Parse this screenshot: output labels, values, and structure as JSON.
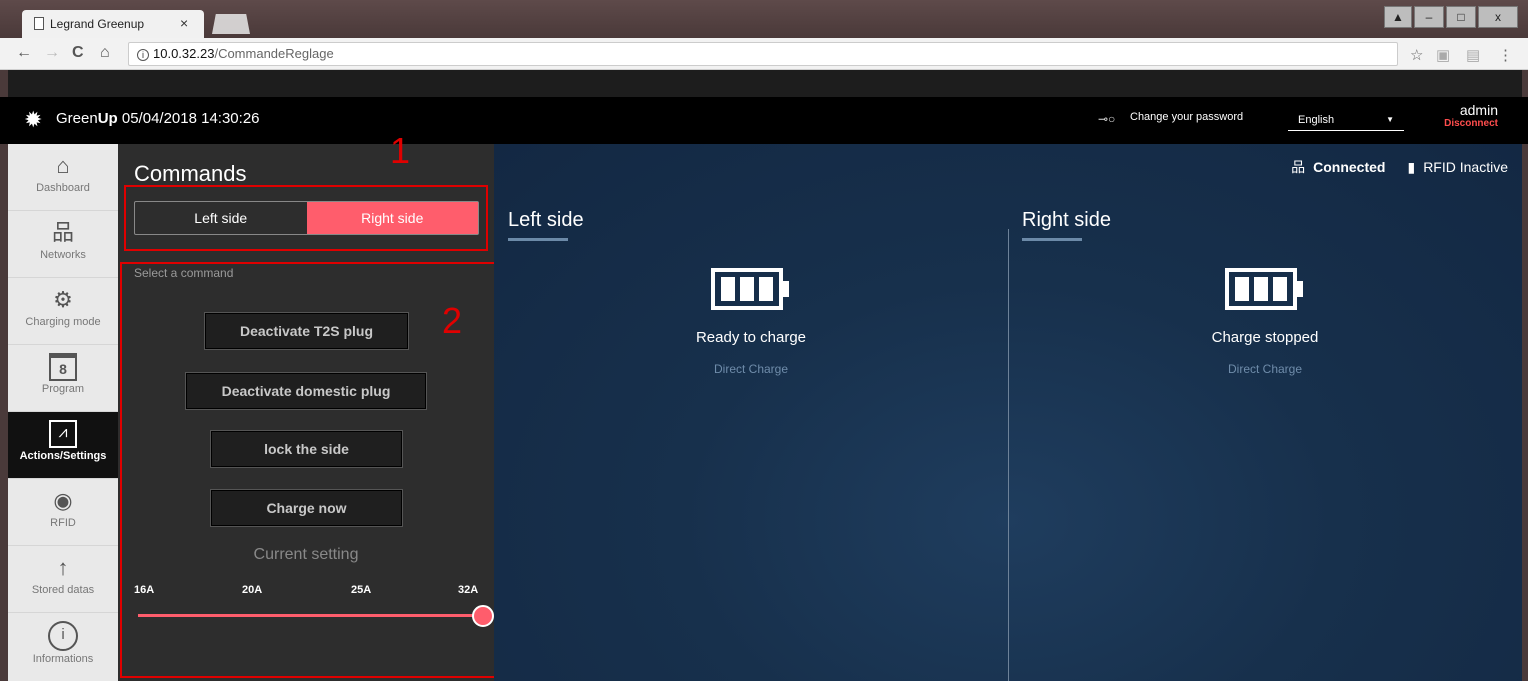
{
  "browser": {
    "tab_title": "Legrand Greenup",
    "tab_close": "×",
    "url_host": "10.0.32.23",
    "url_path": "/CommandeReglage",
    "window_controls": [
      "▲",
      "–",
      "□",
      "x"
    ]
  },
  "header": {
    "brand_prefix": "Green",
    "brand_bold": "Up",
    "datetime": "05/04/2018 14:30:26",
    "change_password": "Change your password",
    "language": "English",
    "user": "admin",
    "disconnect": "Disconnect"
  },
  "sidebar": {
    "items": [
      {
        "label": "Dashboard",
        "icon": "home-icon"
      },
      {
        "label": "Networks",
        "icon": "network-icon"
      },
      {
        "label": "Charging mode",
        "icon": "gear-icon"
      },
      {
        "label": "Program",
        "icon": "calendar-icon",
        "glyph": "8"
      },
      {
        "label": "Actions/Settings",
        "icon": "clipboard-pulse-icon",
        "active": true
      },
      {
        "label": "RFID",
        "icon": "rfid-icon"
      },
      {
        "label": "Stored datas",
        "icon": "upload-icon"
      },
      {
        "label": "Informations",
        "icon": "info-icon"
      }
    ]
  },
  "commands": {
    "title": "Commands",
    "toggle": {
      "left": "Left side",
      "right": "Right side",
      "selected": "right"
    },
    "select_label": "Select a command",
    "buttons": [
      "Deactivate T2S plug",
      "Deactivate domestic plug",
      "lock the side",
      "Charge now"
    ],
    "current_setting_label": "Current setting",
    "current_options": [
      "16A",
      "20A",
      "25A",
      "32A"
    ],
    "current_selected": "32A"
  },
  "annotations": [
    "1",
    "2"
  ],
  "status": {
    "connection": "Connected",
    "rfid": "RFID Inactive"
  },
  "sides": {
    "left": {
      "title": "Left side",
      "state": "Ready to charge",
      "mode": "Direct Charge"
    },
    "right": {
      "title": "Right side",
      "state": "Charge stopped",
      "mode": "Direct Charge"
    }
  },
  "colors": {
    "accent": "#ff5d6c",
    "annotation": "#e00000",
    "main_bg": "#17304c"
  }
}
